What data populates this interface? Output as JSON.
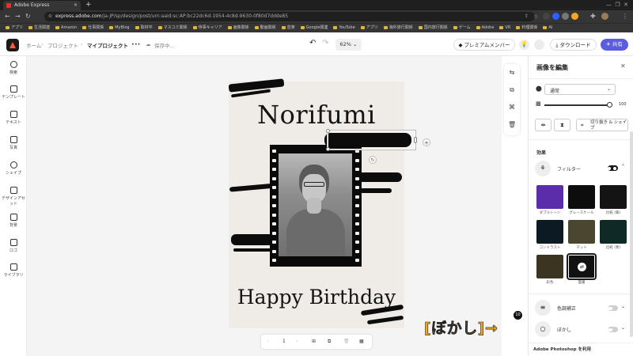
{
  "browser": {
    "tab_title": "Adobe Express",
    "url_host": "express.adobe.com",
    "url_path": "/ja-JP/sp/design/post/urn:aaid:sc:AP:bc22dc6d-1954-4c8d-9630-0f80d7ddde85",
    "bookmarks": [
      "アプリ",
      "生活関連",
      "Amazon",
      "仕事関係",
      "MyBlog",
      "取材中",
      "マスコミ関係",
      "侍事キャリア",
      "画像関係",
      "動画関係",
      "音楽",
      "Google関連",
      "YouTube",
      "アプリ",
      "海外旅行関係",
      "国内旅行関係",
      "ゲーム",
      "Adobe",
      "VR",
      "料理関係",
      "AI"
    ]
  },
  "header": {
    "breadcrumb_home": "ホーム",
    "breadcrumb_projects": "プロジェクト",
    "breadcrumb_current": "マイプロジェクト",
    "more": "•••",
    "save_status": "保存中...",
    "zoom": "62%",
    "premium_label": "プレミアムメンバー",
    "download_label": "ダウンロード",
    "share_label": "共有"
  },
  "left_rail": [
    {
      "label": "検索",
      "icon": "search-icon"
    },
    {
      "label": "テンプレート",
      "icon": "template-icon"
    },
    {
      "label": "テキスト",
      "icon": "text-icon"
    },
    {
      "label": "写真",
      "icon": "photo-icon"
    },
    {
      "label": "シェイプ",
      "icon": "shape-icon"
    },
    {
      "label": "デザインアセット",
      "icon": "design-assets-icon"
    },
    {
      "label": "背景",
      "icon": "background-icon"
    },
    {
      "label": "ロゴ",
      "icon": "logo-icon"
    },
    {
      "label": "ライブラリ",
      "icon": "library-icon"
    }
  ],
  "canvas": {
    "title": "Norifumi",
    "subtitle": "Happy Birthday"
  },
  "page_bar": {
    "page_number": "1"
  },
  "annotation": {
    "text": "[ぼかし]→",
    "badge": "10"
  },
  "panel": {
    "title": "画像を編集",
    "blend_mode": "通常",
    "opacity_value": "100",
    "crop_label": "切り抜き & シェイプ",
    "effects_heading": "効果",
    "filter_label": "フィルター",
    "filters": [
      {
        "label": "ダブルトーン",
        "color": "#5b2dab"
      },
      {
        "label": "グレースケール",
        "color": "#0d0d0d"
      },
      {
        "label": "比較 (暖)",
        "color": "#141414"
      },
      {
        "label": "コントラスト",
        "color": "#0c1a24"
      },
      {
        "label": "マット",
        "color": "#4a4630"
      },
      {
        "label": "比較 (寒)",
        "color": "#0f2a26"
      },
      {
        "label": "彩色",
        "color": "#3a3420"
      },
      {
        "label": "面書",
        "color": "#111111"
      }
    ],
    "color_adjust_label": "色調補正",
    "blur_label": "ぼかし",
    "photoshop_label": "Adobe Photoshop を利用"
  },
  "colors": {
    "accent": "#5c5ce0",
    "toggle_on": "#1a1a1a",
    "toggle_off": "#cfcfcf"
  }
}
